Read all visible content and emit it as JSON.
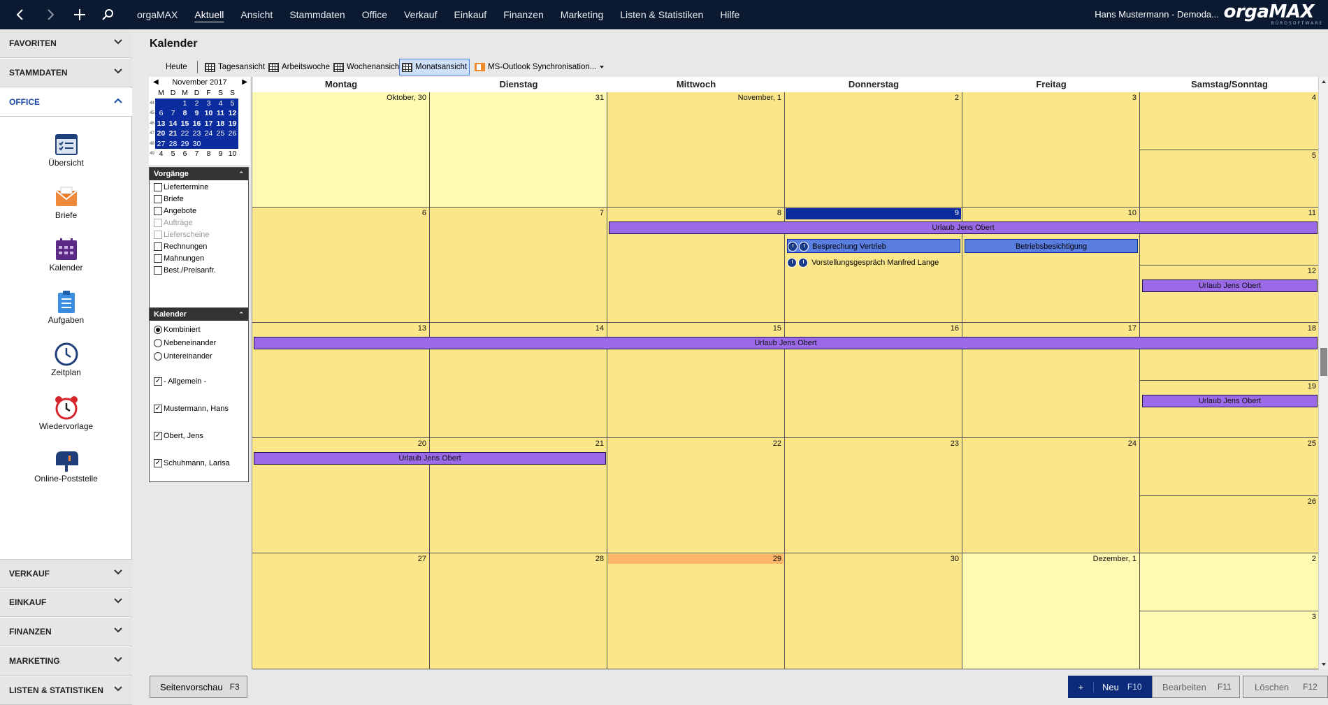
{
  "topbar": {
    "menu": [
      "orgaMAX",
      "Aktuell",
      "Ansicht",
      "Stammdaten",
      "Office",
      "Verkauf",
      "Einkauf",
      "Finanzen",
      "Marketing",
      "Listen & Statistiken",
      "Hilfe"
    ],
    "active_menu": "Aktuell",
    "user": "Hans Mustermann - Demoda...",
    "logo": "orgaMAX",
    "logo_sub": "BÜROSOFTWARE",
    "icons": [
      "back-arrow-icon",
      "forward-arrow-icon",
      "plus-icon",
      "search-icon"
    ]
  },
  "sidebar": {
    "favoriten": "FAVORITEN",
    "stammdaten": "STAMMDATEN",
    "office": "OFFICE",
    "items": [
      {
        "label": "Übersicht",
        "icon": "overview-icon"
      },
      {
        "label": "Briefe",
        "icon": "letter-icon"
      },
      {
        "label": "Kalender",
        "icon": "calendar-icon"
      },
      {
        "label": "Aufgaben",
        "icon": "tasks-icon"
      },
      {
        "label": "Zeitplan",
        "icon": "clock-icon"
      },
      {
        "label": "Wiedervorlage",
        "icon": "alarm-clock-icon"
      },
      {
        "label": "Online-Poststelle",
        "icon": "mailbox-icon"
      }
    ],
    "bottom": [
      "VERKAUF",
      "EINKAUF",
      "FINANZEN",
      "MARKETING",
      "LISTEN & STATISTIKEN"
    ]
  },
  "page": {
    "title": "Kalender"
  },
  "toolbar": {
    "heute": "Heute",
    "tagesansicht": "Tagesansicht",
    "arbeitswoche": "Arbeitswoche",
    "wochenansicht": "Wochenansicht",
    "monatsansicht": "Monatsansicht",
    "outlook": "MS-Outlook Synchronisation..."
  },
  "minical": {
    "month": "November 2017",
    "weekdays": [
      "M",
      "D",
      "M",
      "D",
      "F",
      "S",
      "S"
    ],
    "weeks": [
      {
        "wk": "44",
        "days": [
          "",
          "",
          "1",
          "2",
          "3",
          "4",
          "5"
        ]
      },
      {
        "wk": "45",
        "days": [
          "6",
          "7",
          "8",
          "9",
          "10",
          "11",
          "12"
        ]
      },
      {
        "wk": "46",
        "days": [
          "13",
          "14",
          "15",
          "16",
          "17",
          "18",
          "19"
        ]
      },
      {
        "wk": "47",
        "days": [
          "20",
          "21",
          "22",
          "23",
          "24",
          "25",
          "26"
        ]
      },
      {
        "wk": "48",
        "days": [
          "27",
          "28",
          "29",
          "30",
          "",
          "",
          ""
        ]
      },
      {
        "wk": "49",
        "days": [
          "4",
          "5",
          "6",
          "7",
          "8",
          "9",
          "10"
        ]
      }
    ]
  },
  "vorgaenge": {
    "title": "Vorgänge",
    "items": [
      {
        "label": "Liefertermine",
        "enabled": true
      },
      {
        "label": "Briefe",
        "enabled": true
      },
      {
        "label": "Angebote",
        "enabled": true
      },
      {
        "label": "Aufträge",
        "enabled": false
      },
      {
        "label": "Lieferscheine",
        "enabled": false
      },
      {
        "label": "Rechnungen",
        "enabled": true
      },
      {
        "label": "Mahnungen",
        "enabled": true
      },
      {
        "label": "Best./Preisanfr.",
        "enabled": true
      }
    ]
  },
  "kalender_pane": {
    "title": "Kalender",
    "modes": [
      "Kombiniert",
      "Nebeneinander",
      "Untereinander"
    ],
    "selected_mode": "Kombiniert",
    "calendars": [
      "- Allgemein -",
      "Mustermann, Hans",
      "Obert, Jens",
      "Schuhmann, Larisa"
    ]
  },
  "calendar": {
    "days": [
      "Montag",
      "Dienstag",
      "Mittwoch",
      "Donnerstag",
      "Freitag",
      "Samstag/Sonntag"
    ],
    "rows": [
      {
        "cells": [
          "Oktober, 30",
          "31",
          "November, 1",
          "2",
          "3"
        ],
        "sat": "4",
        "sun": "5"
      },
      {
        "cells": [
          "6",
          "7",
          "8",
          "9",
          "10"
        ],
        "sat": "11",
        "sun": "12"
      },
      {
        "cells": [
          "13",
          "14",
          "15",
          "16",
          "17"
        ],
        "sat": "18",
        "sun": "19"
      },
      {
        "cells": [
          "20",
          "21",
          "22",
          "23",
          "24"
        ],
        "sat": "25",
        "sun": "26"
      },
      {
        "cells": [
          "27",
          "28",
          "29",
          "30",
          "Dezember, 1"
        ],
        "sat": "2",
        "sun": "3"
      }
    ],
    "events": [
      "Urlaub Jens Obert",
      "Besprechung Vertrieb",
      "Betriebsbesichtigung",
      "Vorstellungsgespräch Manfred Lange",
      "Urlaub Jens Obert",
      "Urlaub Jens Obert",
      "Urlaub Jens Obert",
      "Urlaub Jens Obert"
    ],
    "colors": {
      "cell": "#fce68a",
      "cell_other_month": "#fffab2",
      "event": "#9a6ae8",
      "today": "#0a2c9e",
      "highlight": "#ffb66a"
    }
  },
  "bottombar": {
    "seitenvorschau": "Seitenvorschau",
    "seitenvorschau_key": "F3",
    "neu_plus": "+",
    "neu": "Neu",
    "neu_key": "F10",
    "bearbeiten": "Bearbeiten",
    "bearbeiten_key": "F11",
    "loeschen": "Löschen",
    "loeschen_key": "F12"
  }
}
